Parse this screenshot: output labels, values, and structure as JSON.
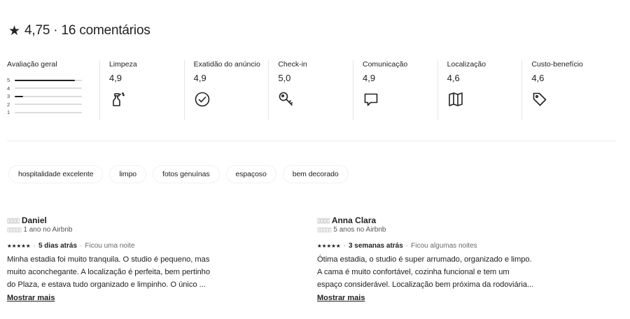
{
  "header": {
    "star": "★",
    "title": "4,75 · 16 comentários"
  },
  "overall": {
    "label": "Avaliação geral",
    "distribution": [
      {
        "stars": "5",
        "fraction": 0.9
      },
      {
        "stars": "4",
        "fraction": 0.0
      },
      {
        "stars": "3",
        "fraction": 0.12
      },
      {
        "stars": "2",
        "fraction": 0.0
      },
      {
        "stars": "1",
        "fraction": 0.0
      }
    ]
  },
  "categories": [
    {
      "label": "Limpeza",
      "value": "4,9",
      "icon": "spray-bottle-icon"
    },
    {
      "label": "Exatidão do anúncio",
      "value": "4,9",
      "icon": "check-circle-icon"
    },
    {
      "label": "Check-in",
      "value": "5,0",
      "icon": "key-icon"
    },
    {
      "label": "Comunicação",
      "value": "4,9",
      "icon": "chat-bubble-icon"
    },
    {
      "label": "Localização",
      "value": "4,6",
      "icon": "map-icon"
    },
    {
      "label": "Custo-benefício",
      "value": "4,6",
      "icon": "tag-icon"
    }
  ],
  "tags": [
    "hospitalidade excelente",
    "limpo",
    "fotos genuínas",
    "espaçoso",
    "bem decorado"
  ],
  "reviews": [
    {
      "name": "Daniel",
      "tenure": "1 ano no Airbnb",
      "stars": "★★★★★",
      "when": "5 dias atrás",
      "stay": "Ficou uma noite",
      "body": "Minha estadia foi muito tranquila. O studio é pequeno, mas\nmuito aconchegante. A localização é perfeita, bem pertinho\ndo Plaza, e estava tudo organizado e limpinho. O único ...",
      "more": "Mostrar mais"
    },
    {
      "name": "Anna Clara",
      "tenure": "5 anos no Airbnb",
      "stars": "★★★★★",
      "when": "3 semanas atrás",
      "stay": "Ficou algumas noites",
      "body": "Ótima estadia, o studio é super arrumado, organizado e limpo.\nA cama é muito confortável, cozinha funcional e tem um\nespaço considerável. Localização bem próxima da rodoviária...",
      "more": "Mostrar mais"
    }
  ],
  "colors": {
    "text": "#222222",
    "divider": "#ebebeb",
    "bar_fill": "#222222",
    "bar_track": "#dcdcdc"
  }
}
